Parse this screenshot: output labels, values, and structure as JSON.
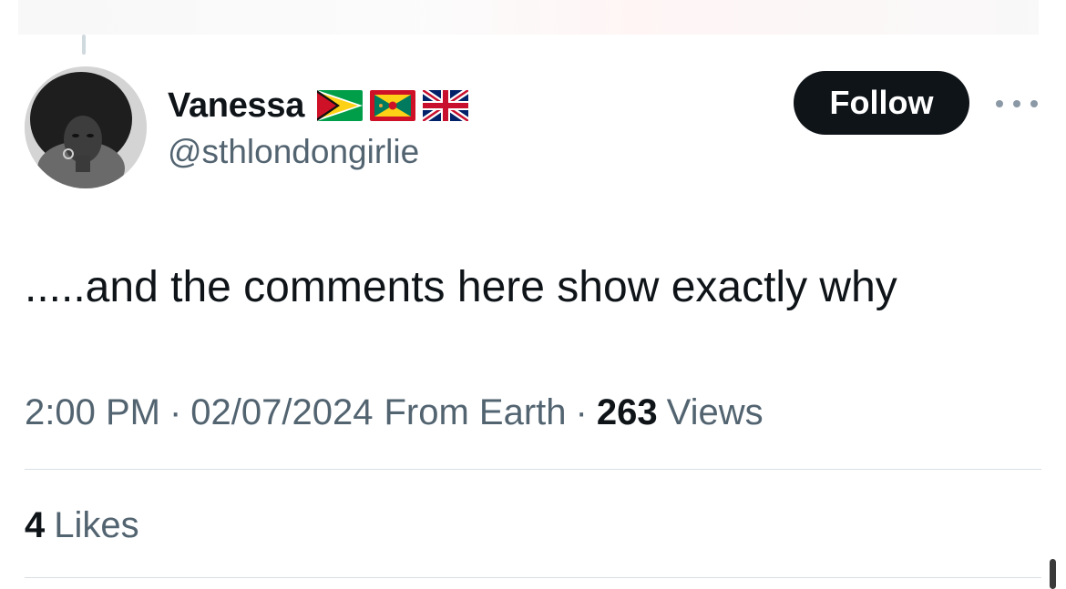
{
  "tweet": {
    "author": {
      "display_name": "Vanessa",
      "handle": "@sthlondongirlie",
      "flags": [
        "guyana-flag-icon",
        "grenada-flag-icon",
        "uk-flag-icon"
      ]
    },
    "follow_label": "Follow",
    "text": ".....and the comments here show exactly why",
    "meta": {
      "time": "2:00 PM",
      "separator": "·",
      "date": "02/07/2024",
      "source": "From Earth",
      "views_count": "263",
      "views_label": "Views"
    },
    "likes": {
      "count": "4",
      "label": "Likes"
    }
  },
  "colors": {
    "text_primary": "#0f1419",
    "text_secondary": "#536471",
    "button_bg": "#0f1419",
    "divider": "#d9dfe3"
  }
}
